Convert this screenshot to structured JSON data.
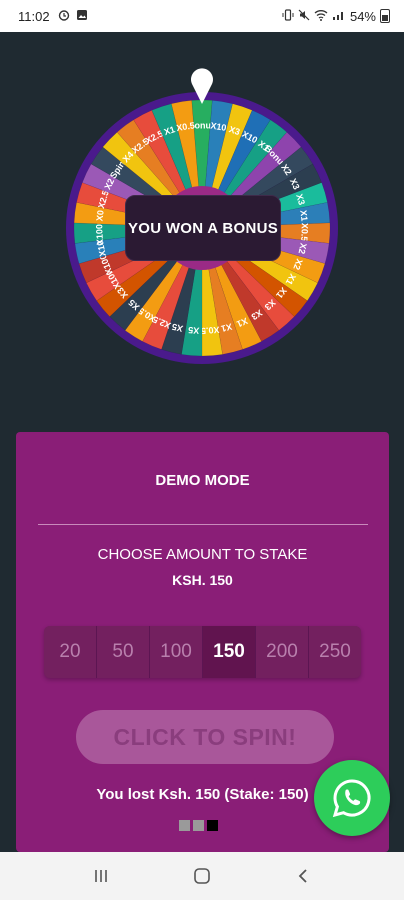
{
  "status_bar": {
    "time": "11:02",
    "battery": "54%",
    "left_icons": [
      "alarm-icon",
      "photo-icon"
    ],
    "right_icons": [
      "vibrate-icon",
      "mute-icon",
      "wifi-icon",
      "signal-icon"
    ]
  },
  "wheel": {
    "segments": [
      {
        "label": "Bonus",
        "color": "#27ae60"
      },
      {
        "label": "X10",
        "color": "#2980b9"
      },
      {
        "label": "X3",
        "color": "#f1c40f"
      },
      {
        "label": "X10",
        "color": "#1f6fb6"
      },
      {
        "label": "X1",
        "color": "#16a085"
      },
      {
        "label": "Bonus",
        "color": "#8e44ad"
      },
      {
        "label": "X2",
        "color": "#34495e"
      },
      {
        "label": "X3",
        "color": "#2c3e50"
      },
      {
        "label": "X3",
        "color": "#1abc9c"
      },
      {
        "label": "X1",
        "color": "#2c7fb8"
      },
      {
        "label": "X0.5",
        "color": "#e67e22"
      },
      {
        "label": "X2",
        "color": "#9b59b6"
      },
      {
        "label": "X2",
        "color": "#f39c12"
      },
      {
        "label": "X1",
        "color": "#f1c40f"
      },
      {
        "label": "X1",
        "color": "#d35400"
      },
      {
        "label": "X3",
        "color": "#e74c3c"
      },
      {
        "label": "X3",
        "color": "#c0392b"
      },
      {
        "label": "X1",
        "color": "#f39c12"
      },
      {
        "label": "X1",
        "color": "#e67e22"
      },
      {
        "label": "X0.5",
        "color": "#f1c40f"
      },
      {
        "label": "X5",
        "color": "#16a085"
      },
      {
        "label": "X5",
        "color": "#2c3e50"
      },
      {
        "label": "X2.5",
        "color": "#e74c3c"
      },
      {
        "label": "X0.5",
        "color": "#f39c12"
      },
      {
        "label": "X5",
        "color": "#2c3e50"
      },
      {
        "label": "X3",
        "color": "#d35400"
      },
      {
        "label": "X100",
        "color": "#e74c3c"
      },
      {
        "label": "X100",
        "color": "#c0392b"
      },
      {
        "label": "X10",
        "color": "#2980b9"
      },
      {
        "label": "X1000",
        "color": "#16a085"
      },
      {
        "label": "X0",
        "color": "#f39c12"
      },
      {
        "label": "X2.5",
        "color": "#e74c3c"
      },
      {
        "label": "X2",
        "color": "#9b59b6"
      },
      {
        "label": "Spin",
        "color": "#34495e"
      },
      {
        "label": "X4",
        "color": "#f1c40f"
      },
      {
        "label": "X2.5",
        "color": "#e67e22"
      },
      {
        "label": "X2.5",
        "color": "#e74c3c"
      },
      {
        "label": "X1",
        "color": "#16a085"
      },
      {
        "label": "X0.5",
        "color": "#f39c12"
      }
    ],
    "rim_color": "#4a1a8c",
    "pointer_color": "#ffffff",
    "hub_color": "#9a2a86"
  },
  "result_message": "YOU WON A BONUS",
  "panel": {
    "mode_label": "DEMO MODE",
    "stake_title": "CHOOSE AMOUNT TO STAKE",
    "stake_amount": "KSH. 150",
    "amounts": [
      "20",
      "50",
      "100",
      "150",
      "200",
      "250"
    ],
    "selected_amount": "150",
    "spin_label": "CLICK TO SPIN!",
    "result_text": "You lost Ksh. 150 (Stake: 150)",
    "page_dots_total": 3,
    "page_dots_active": 3
  },
  "colors": {
    "background": "#1f2a31",
    "panel": "#8a1e77",
    "whatsapp": "#2dcd5a"
  }
}
